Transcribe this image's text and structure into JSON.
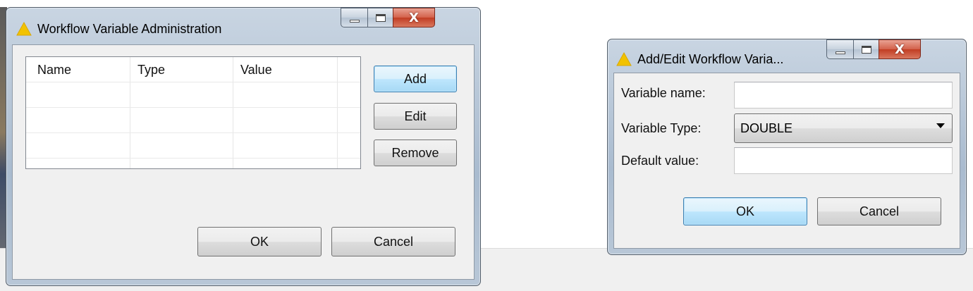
{
  "admin_dialog": {
    "title": "Workflow Variable Administration",
    "table": {
      "columns": [
        "Name",
        "Type",
        "Value"
      ],
      "rows": []
    },
    "buttons": {
      "add": "Add",
      "edit": "Edit",
      "remove": "Remove",
      "ok": "OK",
      "cancel": "Cancel"
    }
  },
  "edit_dialog": {
    "title": "Add/Edit Workflow Varia...",
    "fields": {
      "name_label": "Variable name:",
      "name_value": "",
      "type_label": "Variable Type:",
      "type_value": "DOUBLE",
      "default_label": "Default value:",
      "default_value": ""
    },
    "buttons": {
      "ok": "OK",
      "cancel": "Cancel"
    }
  },
  "icons": {
    "app_icon": "warning-triangle-icon",
    "minimize": "minimize-icon",
    "maximize": "maximize-icon",
    "close": "close-icon",
    "dropdown": "chevron-down-icon"
  },
  "colors": {
    "close_button": "#c94a31",
    "default_button": "#bee6fd",
    "app_icon": "#f2c200"
  }
}
